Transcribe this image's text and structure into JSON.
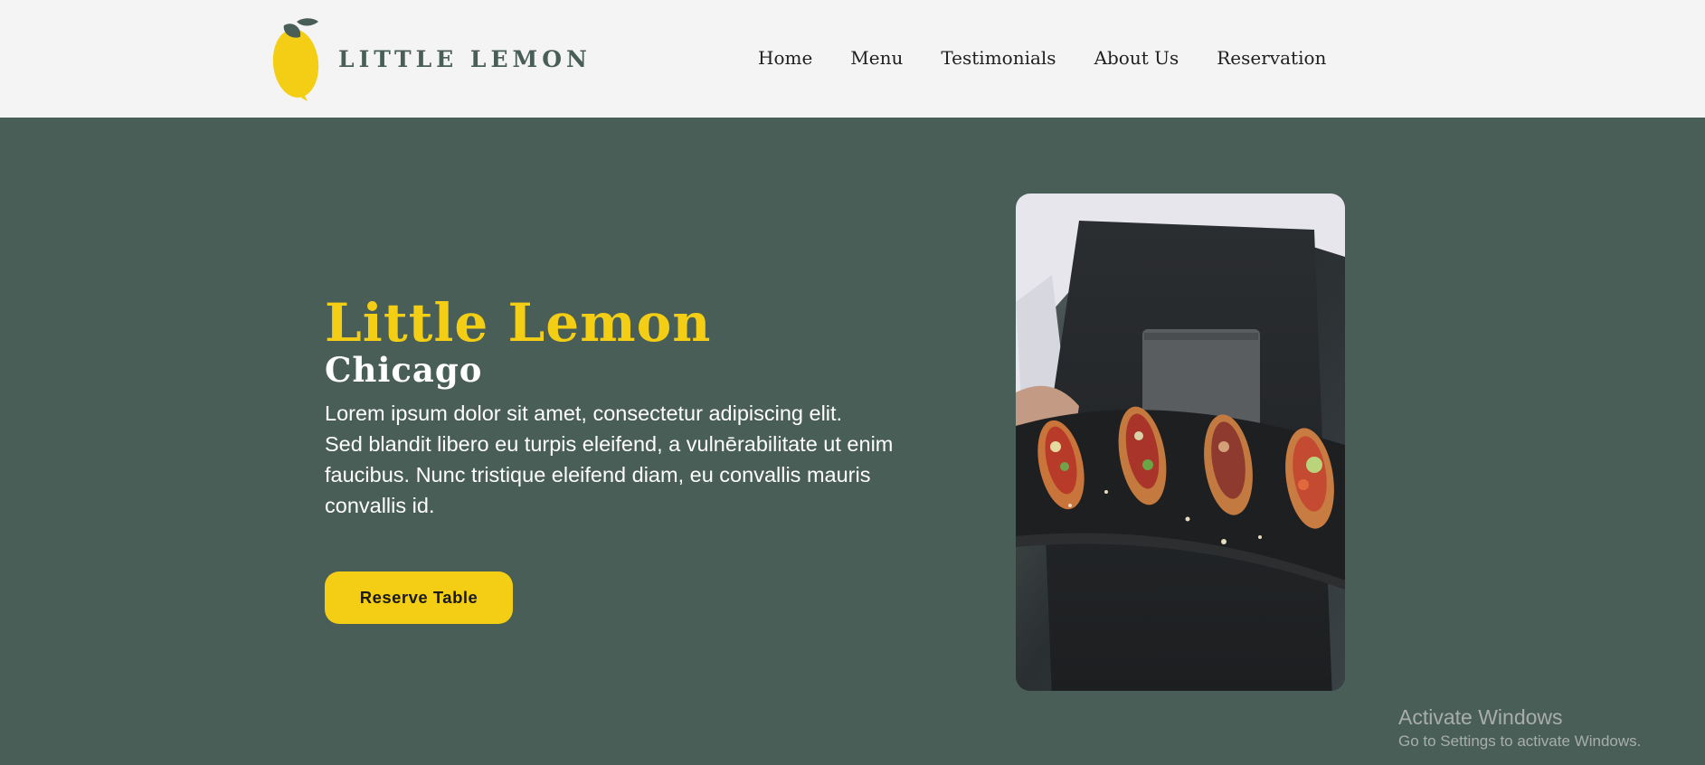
{
  "header": {
    "logo_text": "LITTLE LEMON",
    "logo_icon": "lemon-icon",
    "nav": [
      {
        "label": "Home"
      },
      {
        "label": "Menu"
      },
      {
        "label": "Testimonials"
      },
      {
        "label": "About Us"
      },
      {
        "label": "Reservation"
      }
    ]
  },
  "hero": {
    "title": "Little Lemon",
    "subtitle": "Chicago",
    "description_line1": "Lorem ipsum dolor sit amet, consectetur adipiscing elit.",
    "description_line2": "Sed blandit libero eu turpis eleifend, a vulnērabilitate ut enim faucibus. Nunc tristique eleifend diam, eu convallis mauris convallis id.",
    "button_label": "Reserve Table",
    "image": "chef-serving-bruschetta-photo"
  },
  "system": {
    "watermark_title": "Activate Windows",
    "watermark_subtitle": "Go to Settings to activate Windows."
  },
  "colors": {
    "primary_green": "#495e57",
    "primary_yellow": "#f4ce14",
    "header_bg": "#f4f4f4"
  }
}
